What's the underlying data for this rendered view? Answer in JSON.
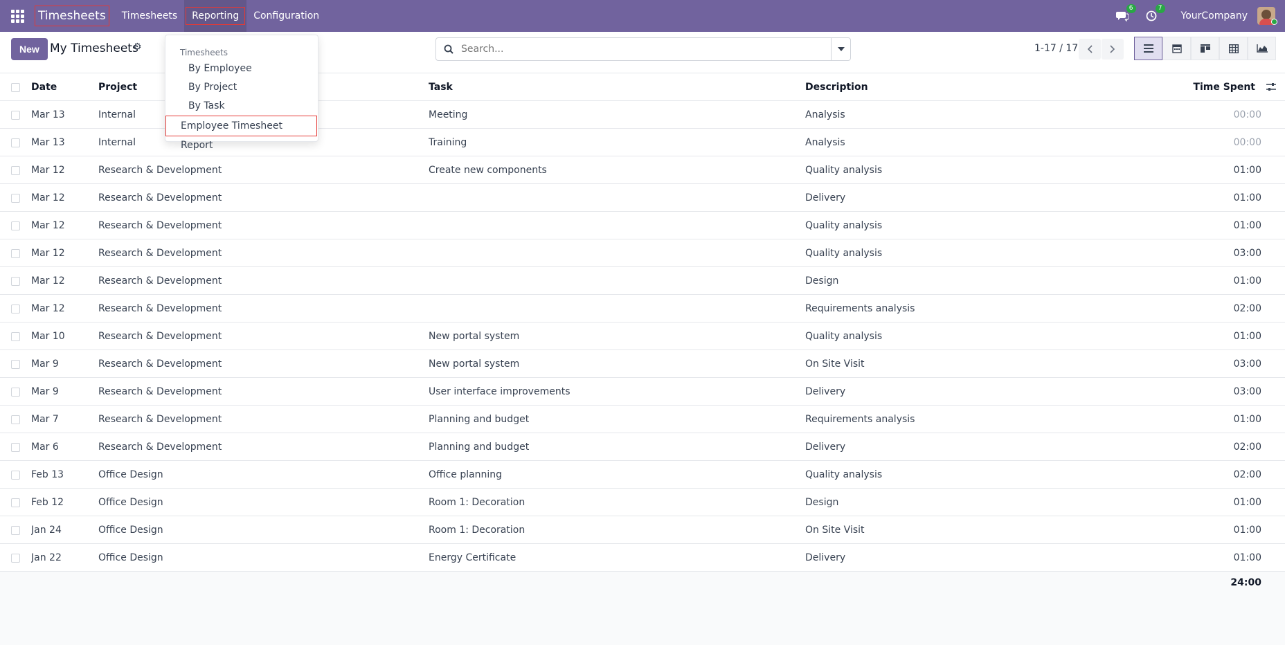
{
  "navbar": {
    "brand": "Timesheets",
    "menu": [
      {
        "label": "Timesheets"
      },
      {
        "label": "Reporting"
      },
      {
        "label": "Configuration"
      }
    ],
    "chat_count": "6",
    "activity_count": "7",
    "company": "YourCompany"
  },
  "control": {
    "new_label": "New",
    "title": "My Timesheets",
    "search_placeholder": "Search...",
    "pager": "1-17 / 17"
  },
  "dropdown": {
    "section": "Timesheets",
    "items": [
      "By Employee",
      "By Project",
      "By Task",
      "Employee Timesheet Report"
    ]
  },
  "table": {
    "headers": {
      "date": "Date",
      "project": "Project",
      "task": "Task",
      "description": "Description",
      "time": "Time Spent"
    },
    "rows": [
      {
        "date": "Mar 13",
        "project": "Internal",
        "task": "Meeting",
        "description": "Analysis",
        "time": "00:00"
      },
      {
        "date": "Mar 13",
        "project": "Internal",
        "task": "Training",
        "description": "Analysis",
        "time": "00:00"
      },
      {
        "date": "Mar 12",
        "project": "Research & Development",
        "task": "Create new components",
        "description": "Quality analysis",
        "time": "01:00"
      },
      {
        "date": "Mar 12",
        "project": "Research & Development",
        "task": "",
        "description": "Delivery",
        "time": "01:00"
      },
      {
        "date": "Mar 12",
        "project": "Research & Development",
        "task": "",
        "description": "Quality analysis",
        "time": "01:00"
      },
      {
        "date": "Mar 12",
        "project": "Research & Development",
        "task": "",
        "description": "Quality analysis",
        "time": "03:00"
      },
      {
        "date": "Mar 12",
        "project": "Research & Development",
        "task": "",
        "description": "Design",
        "time": "01:00"
      },
      {
        "date": "Mar 12",
        "project": "Research & Development",
        "task": "",
        "description": "Requirements analysis",
        "time": "02:00"
      },
      {
        "date": "Mar 10",
        "project": "Research & Development",
        "task": "New portal system",
        "description": "Quality analysis",
        "time": "01:00"
      },
      {
        "date": "Mar 9",
        "project": "Research & Development",
        "task": "New portal system",
        "description": "On Site Visit",
        "time": "03:00"
      },
      {
        "date": "Mar 9",
        "project": "Research & Development",
        "task": "User interface improvements",
        "description": "Delivery",
        "time": "03:00"
      },
      {
        "date": "Mar 7",
        "project": "Research & Development",
        "task": "Planning and budget",
        "description": "Requirements analysis",
        "time": "01:00"
      },
      {
        "date": "Mar 6",
        "project": "Research & Development",
        "task": "Planning and budget",
        "description": "Delivery",
        "time": "02:00"
      },
      {
        "date": "Feb 13",
        "project": "Office Design",
        "task": "Office planning",
        "description": "Quality analysis",
        "time": "02:00"
      },
      {
        "date": "Feb 12",
        "project": "Office Design",
        "task": "Room 1: Decoration",
        "description": "Design",
        "time": "01:00"
      },
      {
        "date": "Jan 24",
        "project": "Office Design",
        "task": "Room 1: Decoration",
        "description": "On Site Visit",
        "time": "01:00"
      },
      {
        "date": "Jan 22",
        "project": "Office Design",
        "task": "Energy Certificate",
        "description": "Delivery",
        "time": "01:00"
      }
    ],
    "total": "24:00"
  },
  "colors": {
    "brand": "#71639e",
    "highlight": "#e53935",
    "badge": "#28a745"
  }
}
